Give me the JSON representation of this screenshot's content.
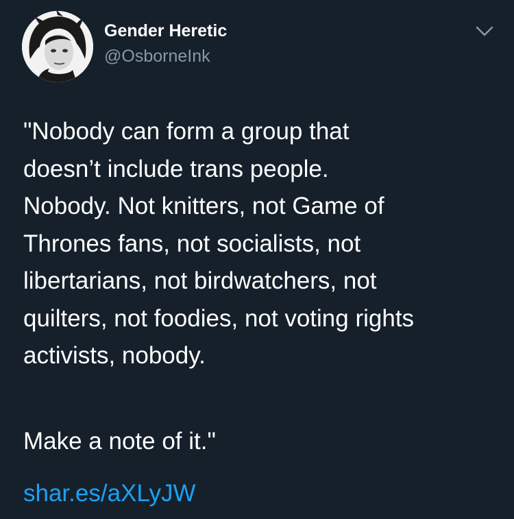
{
  "tweet": {
    "author": {
      "display_name": "Gender Heretic",
      "handle": "@OsborneInk",
      "avatar_icon": "profile-photo"
    },
    "menu_icon": "chevron-down-icon",
    "body_lines": [
      "\"Nobody can form a group that",
      "doesn’t include trans people.",
      "Nobody. Not knitters, not Game of",
      "Thrones fans, not socialists, not",
      "libertarians, not birdwatchers, not",
      "quilters, not foodies, not voting rights",
      "activists, nobody."
    ],
    "closing_line": "Make a note of it.\"",
    "link_text": "shar.es/aXLyJW"
  },
  "colors": {
    "background": "#15202b",
    "primary_text": "#ffffff",
    "secondary_text": "#8899a6",
    "link": "#1da1f2"
  }
}
